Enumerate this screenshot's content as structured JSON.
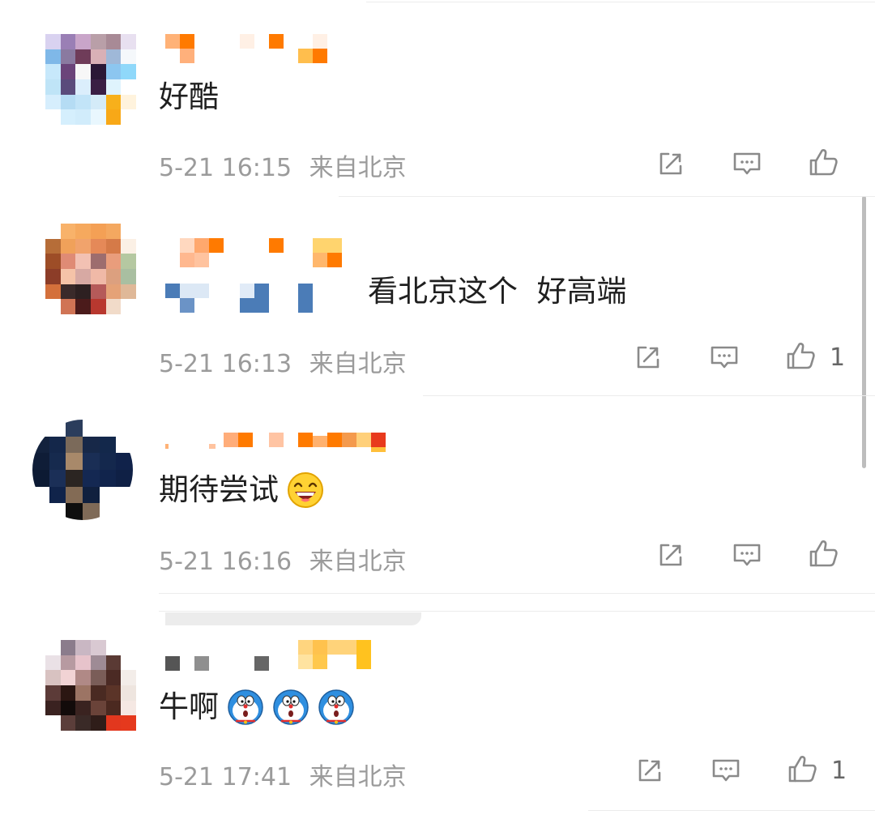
{
  "comments": [
    {
      "text": "好酷",
      "time": "5-21 16:15",
      "location": "来自北京",
      "like_count": "",
      "emojis": []
    },
    {
      "text": "看北京这个  好高端",
      "time": "5-21 16:13",
      "location": "来自北京",
      "like_count": "1",
      "emojis": []
    },
    {
      "text": "期待尝试",
      "time": "5-21 16:16",
      "location": "来自北京",
      "like_count": "",
      "emojis": [
        "laughing-emoji"
      ]
    },
    {
      "text": "牛啊",
      "time": "5-21 17:41",
      "location": "来自北京",
      "like_count": "1",
      "emojis": [
        "doraemon-emoji",
        "doraemon-emoji",
        "doraemon-emoji"
      ]
    }
  ],
  "icons": {
    "share": "share-icon",
    "reply": "comment-icon",
    "like": "thumbs-up-icon"
  },
  "colors": {
    "meta_text": "#9b9b9b",
    "body_text": "#1f1f1f",
    "icon_gray": "#8a8a8a",
    "name_orange": "#ff7a00",
    "name_blue": "#4b7cb7"
  }
}
